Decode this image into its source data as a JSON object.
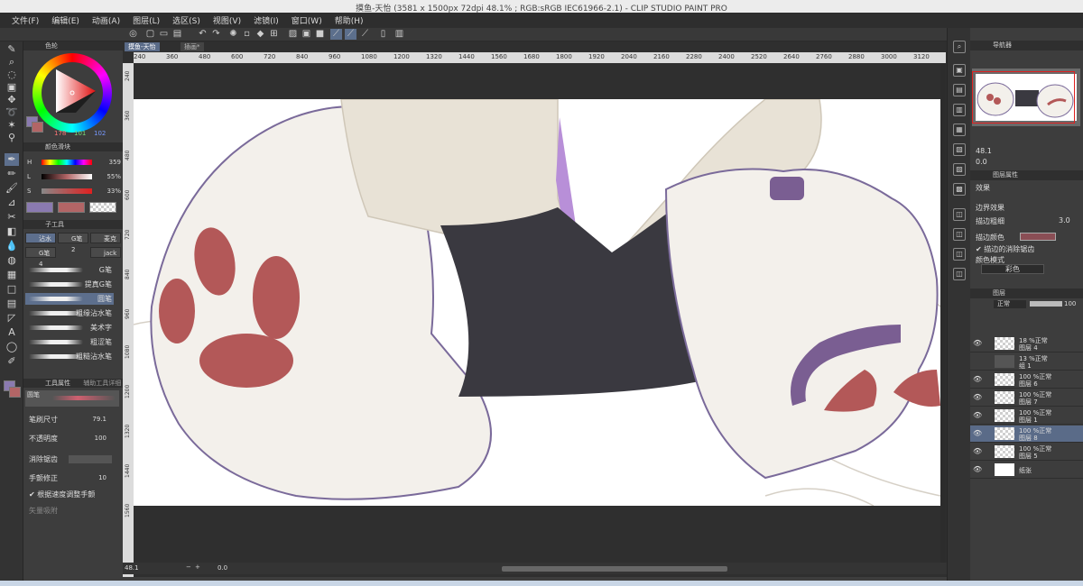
{
  "window": {
    "title": "摸鱼-天怡 (3581 x 1500px 72dpi 48.1% ; RGB:sRGB IEC61966-2.1) - CLIP STUDIO PAINT PRO"
  },
  "menu": [
    "文件(F)",
    "编辑(E)",
    "动画(A)",
    "图层(L)",
    "选区(S)",
    "视图(V)",
    "滤镜(I)",
    "窗口(W)",
    "帮助(H)"
  ],
  "left": {
    "color_tab": "色轮",
    "color_values": {
      "r": "178",
      "g": "101",
      "b": "102"
    },
    "color_slider_tab": "颜色滑块",
    "sliders": [
      {
        "label": "H",
        "value": "359"
      },
      {
        "label": "L",
        "value": "55%"
      },
      {
        "label": "S",
        "value": "33%"
      }
    ],
    "subtool_tab": "子工具",
    "subtools": [
      "沾水",
      "G笔 2",
      "麦克",
      "G笔 4",
      "jack"
    ],
    "brushes": [
      "G笔",
      "提真G笔",
      "圆笔",
      "粗缘沾水笔",
      "美术字",
      "粗涩笔",
      "粗糙沾水笔"
    ],
    "toolprop_tab": "工具属性",
    "toolprop_tab2": "辅助工具详细",
    "current_brush": "圆笔",
    "props": [
      {
        "label": "笔刷尺寸",
        "value": "79.1"
      },
      {
        "label": "不透明度",
        "value": "100"
      },
      {
        "label": "消除锯齿",
        "value": ""
      },
      {
        "label": "手颤修正",
        "value": "10"
      }
    ],
    "check_label": "根据速度调整手颤",
    "vector_label": "矢量吸附"
  },
  "canvas": {
    "tab_active": "摸鱼-天怡",
    "tab_inactive": "插画*",
    "ruler_marks": [
      "240",
      "360",
      "480",
      "600",
      "720",
      "840",
      "960",
      "1080",
      "1200",
      "1320",
      "1440",
      "1560",
      "1680",
      "1800",
      "1920",
      "2040",
      "2160",
      "2280",
      "2400",
      "2520",
      "2640",
      "2760",
      "2880",
      "3000",
      "3120"
    ],
    "vruler_marks": [
      "240",
      "360",
      "480",
      "600",
      "720",
      "840",
      "960",
      "1080",
      "1200",
      "1320",
      "1440",
      "1560"
    ],
    "status_zoom": "48.1",
    "status_angle": "0.0"
  },
  "right": {
    "navigator_tab": "导航器",
    "nav_zoom": "48.1",
    "nav_angle": "0.0",
    "layer_prop_tab": "图层属性",
    "effect_label": "效果",
    "border_effect": "边界效果",
    "edge_width_label": "描边粗细",
    "edge_width_value": "3.0",
    "edge_color_label": "描边颜色",
    "antialias_label": "描边的消除锯齿",
    "color_mode_label": "颜色模式",
    "color_mode_value": "彩色",
    "layer_tab": "图层",
    "blend_mode": "正常",
    "opacity": "100",
    "layers": [
      {
        "line1": "18 %正常",
        "line2": "图层 4"
      },
      {
        "line1": "13 %正常",
        "line2": "组 1"
      },
      {
        "line1": "100 %正常",
        "line2": "图层 6"
      },
      {
        "line1": "100 %正常",
        "line2": "图层 7"
      },
      {
        "line1": "100 %正常",
        "line2": "图层 1"
      },
      {
        "line1": "100 %正常",
        "line2": "图层 8"
      },
      {
        "line1": "100 %正常",
        "line2": "图层 5"
      },
      {
        "line1": "",
        "line2": "纸张"
      }
    ]
  },
  "colors": {
    "main": "#b26566",
    "accent": "#5a6b88",
    "border": "#7a6a9a"
  }
}
